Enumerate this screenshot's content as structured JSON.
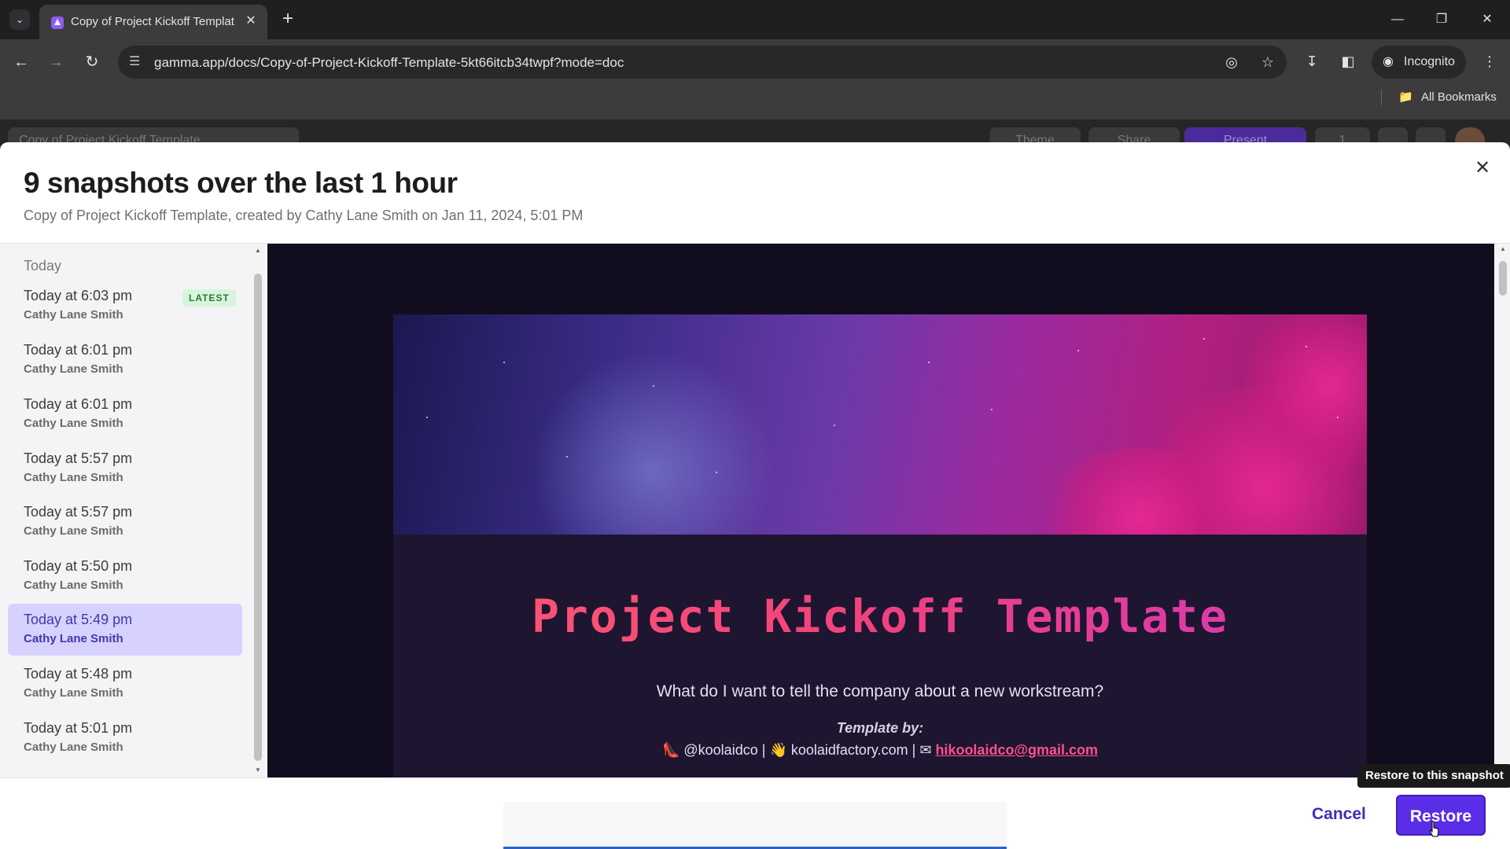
{
  "browser": {
    "tab_title": "Copy of Project Kickoff Templat",
    "url": "gamma.app/docs/Copy-of-Project-Kickoff-Template-5kt66itcb34twpf?mode=doc",
    "incognito_label": "Incognito",
    "bookmarks_label": "All Bookmarks"
  },
  "app_bar": {
    "breadcrumb": "Copy of Project Kickoff Template",
    "theme_label": "Theme",
    "share_label": "Share",
    "present_label": "Present",
    "comments_count": "1"
  },
  "modal": {
    "title": "9 snapshots over the last 1 hour",
    "subtitle": "Copy of Project Kickoff Template, created by Cathy Lane Smith on Jan 11, 2024, 5:01 PM",
    "sidebar_header": "Today",
    "latest_badge": "LATEST",
    "snapshots": [
      {
        "time": "Today at 6:03 pm",
        "author": "Cathy Lane Smith"
      },
      {
        "time": "Today at 6:01 pm",
        "author": "Cathy Lane Smith"
      },
      {
        "time": "Today at 6:01 pm",
        "author": "Cathy Lane Smith"
      },
      {
        "time": "Today at 5:57 pm",
        "author": "Cathy Lane Smith"
      },
      {
        "time": "Today at 5:57 pm",
        "author": "Cathy Lane Smith"
      },
      {
        "time": "Today at 5:50 pm",
        "author": "Cathy Lane Smith"
      },
      {
        "time": "Today at 5:49 pm",
        "author": "Cathy Lane Smith"
      },
      {
        "time": "Today at 5:48 pm",
        "author": "Cathy Lane Smith"
      },
      {
        "time": "Today at 5:01 pm",
        "author": "Cathy Lane Smith"
      }
    ],
    "cancel_label": "Cancel",
    "restore_label": "Restore",
    "restore_tooltip": "Restore to this snapshot"
  },
  "preview": {
    "title": "Project Kickoff Template",
    "question": "What do I want to tell the company about a new workstream?",
    "template_by": "Template by:",
    "handle": "@koolaidco",
    "site": "koolaidfactory.com",
    "email": "hikoolaidco@gmail.com",
    "separator": "|"
  },
  "colors": {
    "accent": "#5b2de8",
    "selected_row": "#d7d1ff",
    "latest_badge_bg": "#d8f4dd",
    "preview_bg": "#120d1e",
    "email_link": "#ff4f8a"
  },
  "icons": {
    "handle_icon": "shoe-icon",
    "site_icon": "waving-hand-icon",
    "email_icon": "envelope-icon"
  }
}
